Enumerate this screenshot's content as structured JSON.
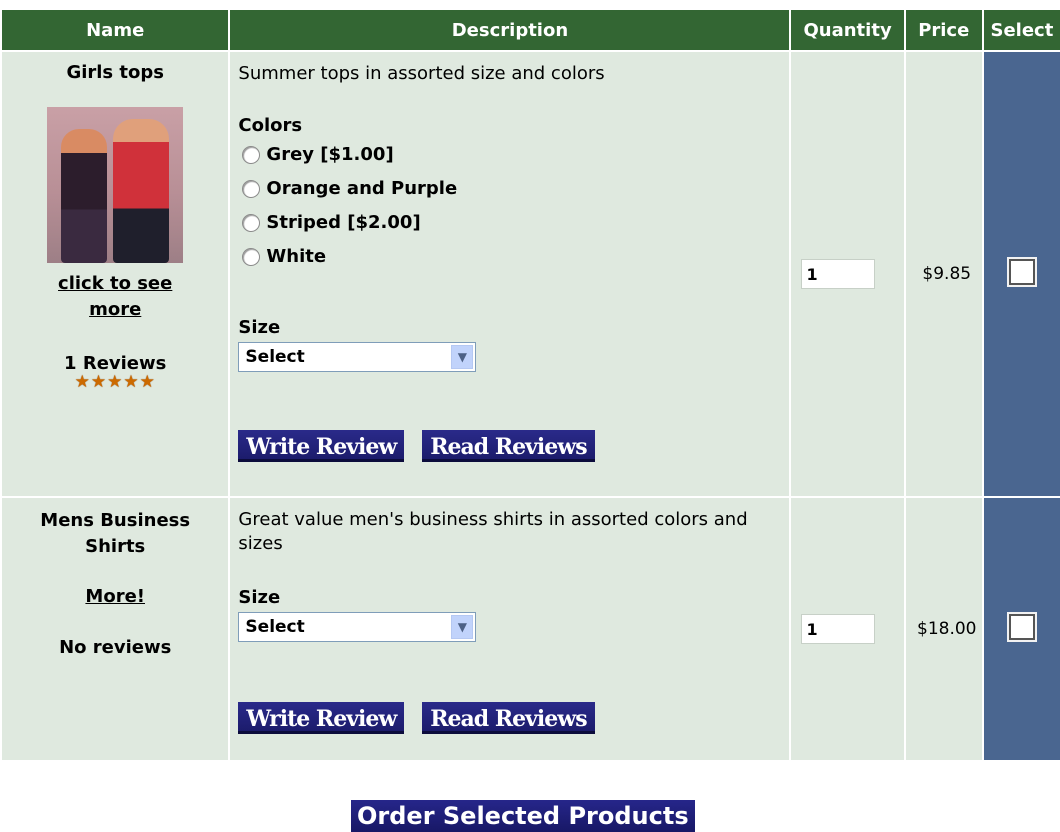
{
  "table": {
    "headers": [
      "Name",
      "Description",
      "Quantity",
      "Price",
      "Select"
    ]
  },
  "products": [
    {
      "name": "Girls tops",
      "link_text": "click to see more",
      "reviews": "1 Reviews",
      "stars": "★★★★★",
      "description": "Summer tops in assorted size and colors",
      "colors_label": "Colors",
      "colors": [
        "Grey [$1.00]",
        "Orange and Purple",
        "Striped [$2.00]",
        "White"
      ],
      "size_label": "Size",
      "size_value": "Select",
      "write_review": "Write Review",
      "read_reviews": "Read Reviews",
      "quantity": "1",
      "price": "$9.85"
    },
    {
      "name": "Mens Business Shirts",
      "link_text": "More!",
      "reviews": "No reviews",
      "description": "Great value men's business shirts in assorted colors and sizes",
      "size_label": "Size",
      "size_value": "Select",
      "write_review": "Write Review",
      "read_reviews": "Read Reviews",
      "quantity": "1",
      "price": "$18.00"
    }
  ],
  "order_button": "Order Selected Products",
  "colors": {
    "header_bg": "#336633",
    "row_bg": "#dfe9df",
    "select_col_bg": "#4a6690",
    "button_bg": "#1c1c6c"
  }
}
